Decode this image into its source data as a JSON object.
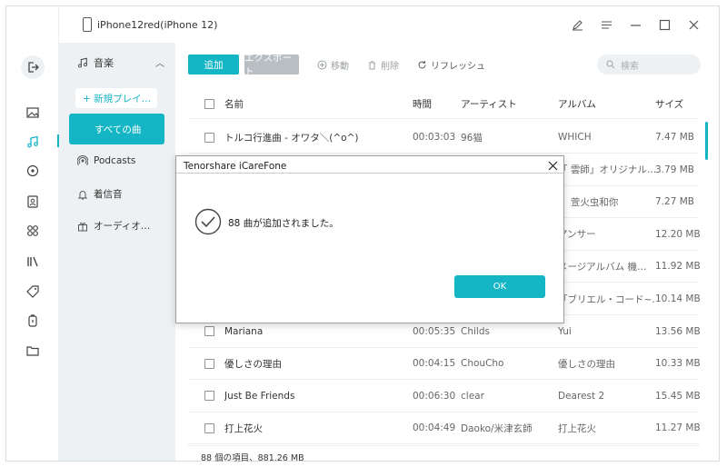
{
  "window": {
    "device_name": "iPhone12red(iPhone 12)"
  },
  "rail": {
    "icons": [
      "exit-icon",
      "photos-icon",
      "music-icon",
      "video-icon",
      "contacts-icon",
      "apps-icon",
      "books-icon",
      "tag-icon",
      "backup-icon",
      "folder-icon"
    ],
    "active": "music-icon"
  },
  "sidebar": {
    "header": "音楽",
    "new_playlist": "+ 新規プレイ…",
    "all_songs": "すべての曲",
    "items": [
      {
        "label": "Podcasts",
        "icon": "podcast-icon"
      },
      {
        "label": "着信音",
        "icon": "bell-icon"
      },
      {
        "label": "オーディオ…",
        "icon": "gift-icon"
      }
    ]
  },
  "toolbar": {
    "add": "追加",
    "export": "エクスポート",
    "move": "移動",
    "delete": "削除",
    "refresh": "リフレッシュ",
    "search_placeholder": "検索"
  },
  "table": {
    "columns": [
      "名前",
      "時間",
      "アーティスト",
      "アルバム",
      "サイズ"
    ],
    "rows": [
      {
        "name": "トルコ行進曲 - オワタ＼(^o^)",
        "time": "00:03:03",
        "artist": "96猫",
        "album": "WHICH",
        "size": "7.47 MB"
      },
      {
        "name": "",
        "time": "",
        "artist": "",
        "album": "「 雲師」オリジナル…",
        "size": "3.79 MB"
      },
      {
        "name": "",
        "time": "",
        "artist": "",
        "album": "、 萱火虫和你",
        "size": "7.27 MB"
      },
      {
        "name": "",
        "time": "",
        "artist": "",
        "album": "アンサー",
        "size": "12.20 MB"
      },
      {
        "name": "",
        "time": "",
        "artist": "",
        "album": "メージアルバム 機…",
        "size": "11.92 MB"
      },
      {
        "name": "",
        "time": "",
        "artist": "",
        "album": "「ブリエル・コード~…",
        "size": "10.14 MB"
      },
      {
        "name": "Mariana",
        "time": "00:05:35",
        "artist": "Childs",
        "album": "Yui",
        "size": "13.56 MB"
      },
      {
        "name": "優しさの理由",
        "time": "00:04:15",
        "artist": "ChouCho",
        "album": "優しさの理由",
        "size": "10.33 MB"
      },
      {
        "name": "Just Be Friends",
        "time": "00:06:30",
        "artist": "clear",
        "album": "Dearest 2",
        "size": "15.45 MB"
      },
      {
        "name": "打上花火",
        "time": "00:04:49",
        "artist": "Daoko/米津玄師",
        "album": "打上花火",
        "size": "11.27 MB"
      }
    ]
  },
  "status": {
    "summary": "88 個の項目、881.26 MB"
  },
  "dialog": {
    "title": "Tenorshare iCareFone",
    "message": "88 曲が追加されました。",
    "ok": "OK"
  },
  "colors": {
    "accent": "#14b5c4",
    "sidebar_bg": "#eef1f3",
    "disabled_button": "#b9bec2"
  }
}
